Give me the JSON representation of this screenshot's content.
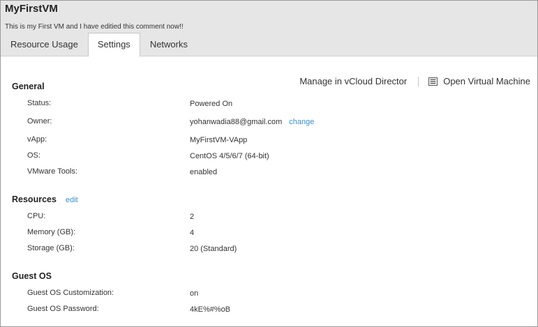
{
  "vm": {
    "name": "MyFirstVM",
    "description": "This is my First VM and I have editied this comment now!!"
  },
  "tabs": [
    {
      "label": "Resource Usage"
    },
    {
      "label": "Settings",
      "active": true
    },
    {
      "label": "Networks"
    }
  ],
  "actions": {
    "manage_label": "Manage in vCloud Director",
    "open_label": "Open Virtual Machine",
    "open_icon": "document-icon"
  },
  "general": {
    "title": "General",
    "status_label": "Status:",
    "status_value": "Powered On",
    "owner_label": "Owner:",
    "owner_value": "yohanwadia88@gmail.com",
    "owner_change": "change",
    "vapp_label": "vApp:",
    "vapp_value": "MyFirstVM-VApp",
    "os_label": "OS:",
    "os_value": "CentOS 4/5/6/7 (64-bit)",
    "tools_label": "VMware Tools:",
    "tools_value": "enabled"
  },
  "resources": {
    "title": "Resources",
    "edit": "edit",
    "cpu_label": "CPU:",
    "cpu_value": "2",
    "memory_label": "Memory (GB):",
    "memory_value": "4",
    "storage_label": "Storage (GB):",
    "storage_value": "20 (Standard)"
  },
  "guest_os": {
    "title": "Guest OS",
    "customization_label": "Guest OS Customization:",
    "customization_value": "on",
    "password_label": "Guest OS Password:",
    "password_value": "4kE%#%oB"
  },
  "colors": {
    "header_bg": "#e6e6e6",
    "link": "#3a8fc7"
  }
}
